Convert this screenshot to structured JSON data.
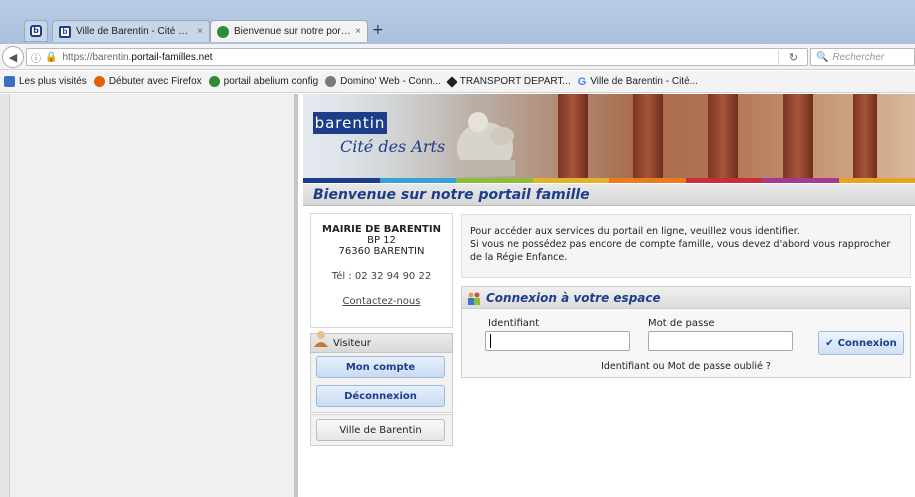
{
  "browser": {
    "tabs": [
      {
        "label": "Ville de Barentin - Cité des ...",
        "close": "×"
      },
      {
        "label": "Bienvenue sur notre portail...",
        "close": "×"
      }
    ],
    "new_tab": "+",
    "url_prefix": "https://barentin.",
    "url_domain": "portail-familles.net",
    "search_placeholder": "Rechercher",
    "bookmarks": [
      {
        "label": "Les plus visités",
        "color": "#3b6fc4"
      },
      {
        "label": "Débuter avec Firefox",
        "color": "#e66000"
      },
      {
        "label": "portail abelium config",
        "color": "#2f8a3a"
      },
      {
        "label": "Domino' Web - Conn...",
        "color": "#7a7a7a"
      },
      {
        "label": "TRANSPORT DEPART...",
        "color": "#222222"
      },
      {
        "label": "Ville de Barentin - Cité...",
        "color": "#4285f4"
      }
    ]
  },
  "banner": {
    "logo": "barentin",
    "tagline": "Cité des Arts",
    "color_stripes": [
      "#1c3e8a",
      "#3aa0d8",
      "#8dbb3a",
      "#e2b22b",
      "#e87c1e",
      "#c92f3b",
      "#a63a8b",
      "#e9a21f"
    ]
  },
  "page": {
    "title": "Bienvenue sur notre portail famille"
  },
  "info": {
    "name": "MAIRIE DE BARENTIN",
    "bp": "BP 12",
    "city": "76360 BARENTIN",
    "phone": "Tél : 02 32 94 90 22",
    "contact_link": "Contactez-nous"
  },
  "visitor": {
    "heading": "Visiteur",
    "account_button": "Mon compte",
    "logout_button": "Déconnexion",
    "city_button": "Ville de Barentin"
  },
  "main": {
    "intro_line1": "Pour accéder aux services du portail en ligne, veuillez vous identifier.",
    "intro_line2": "Si vous ne possédez pas encore de compte famille, vous devez d'abord vous rapprocher de la Régie Enfance."
  },
  "login": {
    "heading": "Connexion à votre espace",
    "id_label": "Identifiant",
    "id_value": "",
    "password_label": "Mot de passe",
    "password_value": "",
    "submit": "Connexion",
    "forgot_link": "Identifiant ou Mot de passe oublié ?"
  }
}
